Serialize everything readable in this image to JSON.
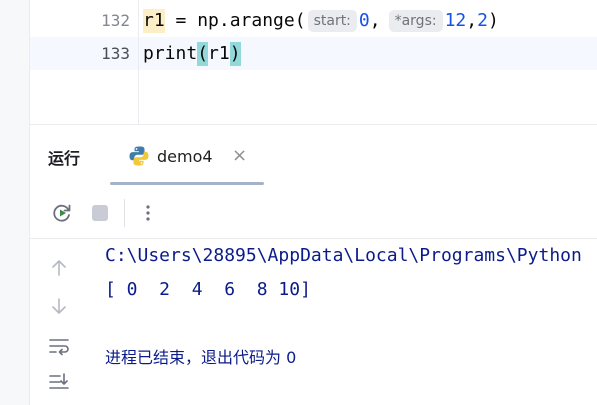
{
  "editor": {
    "lines": [
      {
        "number": "132",
        "var": "r1",
        "assign": " = np.arange(",
        "hint_start": "start:",
        "arg_start": "0",
        "comma": ",",
        "hint_args": "*args:",
        "arg_stop": "12",
        "comma2": ",",
        "arg_step": "2",
        "close": ")"
      },
      {
        "number": "133",
        "func": "print",
        "open_paren": "(",
        "arg": "r1",
        "close_paren": ")"
      }
    ]
  },
  "tool_window": {
    "title": "运行",
    "tab": {
      "label": "demo4",
      "icon": "python-icon",
      "close": "×"
    }
  },
  "toolbar": {
    "rerun_icon": "rerun-icon",
    "stop_icon": "stop-icon",
    "more_icon": "more-vertical-icon"
  },
  "console": {
    "lines": [
      "C:\\Users\\28895\\AppData\\Local\\Programs\\Python",
      "[ 0  2  4  6  8 10]"
    ],
    "exit_message": "进程已结束，退出代码为 0"
  },
  "colors": {
    "accent_tab_underline": "#a4b3c9",
    "console_text": "#0b1c8a",
    "number": "#1750eb",
    "python_blue": "#3f7cac",
    "python_yellow": "#f0c93a",
    "rerun_green": "#3b8a47"
  }
}
